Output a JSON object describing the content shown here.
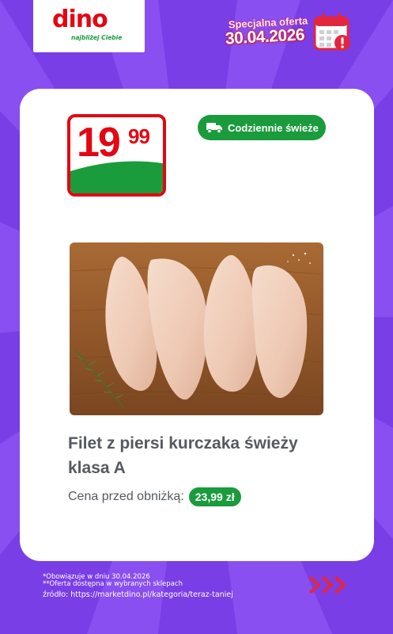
{
  "header": {
    "logo_text": "dino",
    "logo_tagline": "najbliżej Ciebie",
    "offer_label": "Specjalna oferta",
    "offer_date": "30.04.2026"
  },
  "product": {
    "price_int": "19",
    "price_dec": "99",
    "badge": "Codziennie świeże",
    "name_line1": "Filet z piersi kurczaka świeży",
    "name_line2": "klasa A",
    "before_label": "Cena przed obniżką:",
    "before_price": "23,99 zł"
  },
  "footer": {
    "note1": "*Obowiązuje w dniu 30.04.2026",
    "note2": "**Oferta dostępna w wybranych sklepach",
    "source": "źródło: https://marketdino.pl/kategoria/teraz-taniej"
  },
  "colors": {
    "background": "#8a4ff0",
    "brand_red": "#e30613",
    "brand_green": "#1a9b3c"
  },
  "icons": [
    "calendar-icon",
    "delivery-truck-icon",
    "triple-chevron-right-icon"
  ]
}
